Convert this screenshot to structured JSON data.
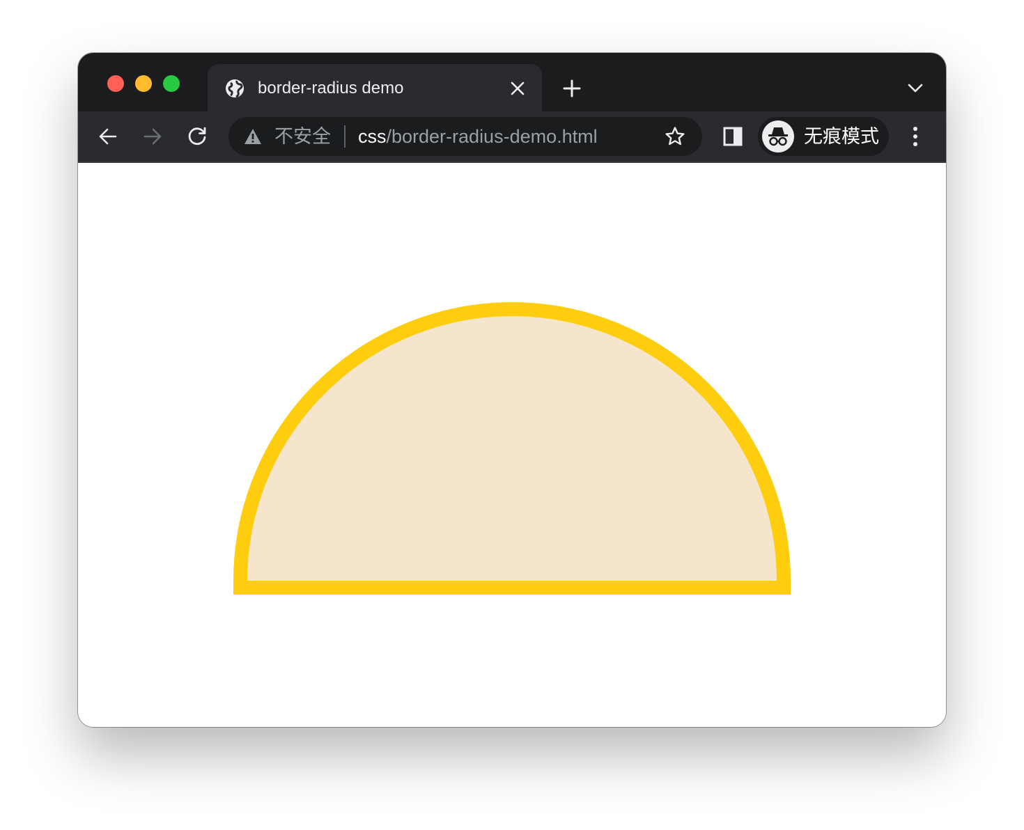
{
  "window": {
    "traffic_lights": {
      "close_color": "#fe5f57",
      "minimize_color": "#febc2e",
      "maximize_color": "#28c840"
    }
  },
  "tab": {
    "title": "border-radius demo",
    "favicon": "globe-icon"
  },
  "toolbar": {
    "security_label": "不安全",
    "url_host": "css",
    "url_path": "/border-radius-demo.html",
    "incognito_label": "无痕模式"
  },
  "icons": {
    "back": "arrow-left-icon",
    "forward": "arrow-right-icon",
    "reload": "reload-icon",
    "warning": "warning-triangle-icon",
    "bookmark": "star-icon",
    "side_panel": "side-panel-icon",
    "incognito": "incognito-icon",
    "menu": "more-vertical-icon",
    "new_tab": "plus-icon",
    "tab_search": "chevron-down-icon",
    "tab_close": "close-icon"
  },
  "demo": {
    "shape": "half-circle",
    "fill_color": "#f5e5cd",
    "border_color": "#fecd0d"
  }
}
